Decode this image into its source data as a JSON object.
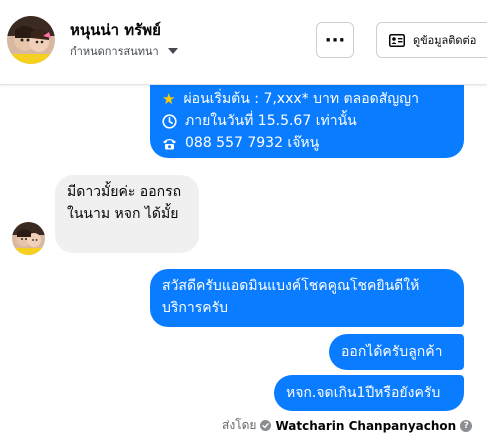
{
  "header": {
    "name": "หนุนน่า ทรัพย์",
    "subtitle": "กำหนดการสนทนา",
    "more_label": "···",
    "contact_label": "ดูข้อมูลติดต่อ"
  },
  "messages": {
    "promo": {
      "line1": "ผ่อนเริ่มต้น : 7,xxx* บาท ตลอดสัญญา",
      "line2": "ภายในวันที่ 15.5.67 เท่านั้น",
      "line3": "088 557 7932 เจ๊หนู"
    },
    "incoming": "มีดาวมั้ยค่ะ ออกรถในนาม หจก ได้มั้ย",
    "reply1": "สวัสดีครับแอดมินแบงค์โชคคูณโชคยินดีให้บริการครับ",
    "reply2": "ออกได้ครับลูกค้า",
    "reply3": "หจก.จดเกิน1ปีหรือยังครับ"
  },
  "footer": {
    "sent_by": "ส่งโดย",
    "sender": "Watcharin Chanpanyachon",
    "help": "?"
  },
  "icons": {
    "promo_line1": "star-icon",
    "promo_line2": "clock-icon",
    "promo_line3": "phone-icon"
  },
  "colors": {
    "outgoing_bubble": "#0a7cff",
    "incoming_bubble": "#f0f0f0"
  }
}
